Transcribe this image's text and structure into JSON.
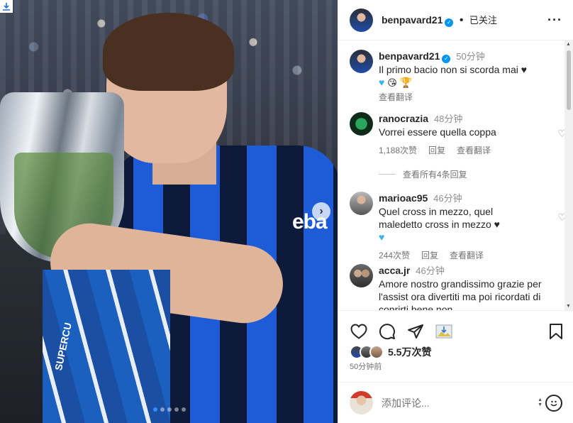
{
  "post": {
    "author": "benpavard21",
    "follow_status": "已关注",
    "jersey_sponsor": "eba",
    "ribbon_text": "SUPERCU"
  },
  "caption": {
    "username": "benpavard21",
    "time": "50分钟",
    "text": "Il primo bacio non si scorda mai",
    "translate": "查看翻译"
  },
  "comments": [
    {
      "username": "ranocrazia",
      "time": "48分钟",
      "text": "Vorrei essere quella coppa",
      "likes": "1,188次赞",
      "reply": "回复",
      "translate": "查看翻译"
    },
    {
      "username": "marioac95",
      "time": "46分钟",
      "text": "Quel cross in mezzo, quel maledetto cross in mezzo",
      "likes": "244次赞",
      "reply": "回复",
      "translate": "查看翻译"
    },
    {
      "username": "acca.jr",
      "time": "46分钟",
      "text": "Amore nostro grandissimo grazie per l'assist ora divertiti ma poi ricordati di coprirti bene non"
    }
  ],
  "view_replies": "查看所有4条回复",
  "likes_total": "5.5万次赞",
  "post_time": "50分钟前",
  "comment_input": {
    "placeholder": "添加评论..."
  },
  "icons": {
    "more": "more-icon",
    "like": "heart-icon",
    "comment": "comment-icon",
    "share": "share-icon",
    "save": "bookmark-icon",
    "emoji": "emoji-icon",
    "verified": "verified-badge-icon",
    "download": "download-icon"
  },
  "colors": {
    "verified": "#0095f6",
    "heart_blue": "#35b4f0",
    "carousel_active": "#2f8fff"
  }
}
